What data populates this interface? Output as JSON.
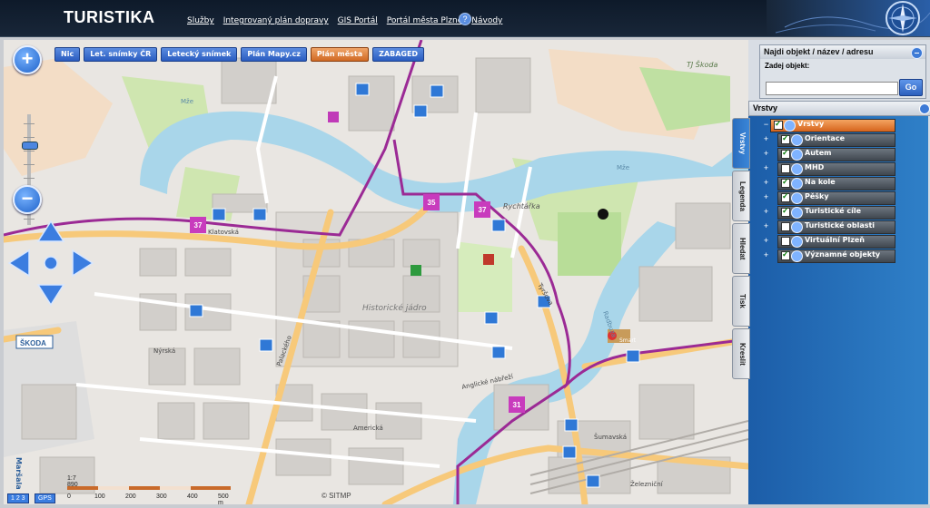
{
  "header": {
    "title": "TURISTIKA",
    "nav": [
      "Služby",
      "Integrovaný plán dopravy",
      "GIS Portál",
      "Portál města Plzně",
      "Návody"
    ],
    "help": "?"
  },
  "map": {
    "buttons": [
      "Nic",
      "Let. snímky ČR",
      "Letecký snímek",
      "Plán Mapy.cz",
      "Plán města",
      "ZABAGED"
    ],
    "active_button": "Plán města",
    "zoom_in": "+",
    "zoom_out": "−",
    "labels": {
      "district": "Historické jádro",
      "river1": "Mže",
      "river2": "Mže",
      "river3": "Radbuza",
      "street1": "Klatovská",
      "street2": "Americká",
      "street3": "Anglické nábřeží",
      "street4": "Šumavská",
      "street5": "Železniční",
      "street6": "Tyršova",
      "street7": "Palackého",
      "street8": "Nýrská",
      "tj": "TJ Škoda",
      "skoda": "ŠKODA",
      "rychtarka": "Rychtářka",
      "marshala": "Maršala",
      "smart": "Smart"
    },
    "route_badges": [
      "37",
      "35",
      "37",
      "31"
    ],
    "scale": {
      "ratio": "1:7 890",
      "ticks": [
        "0",
        "100",
        "200",
        "300",
        "400",
        "500 m"
      ]
    },
    "copyright": "© SITMP",
    "corner_buttons": [
      "1 2 3",
      "GPS"
    ]
  },
  "panel": {
    "find_title": "Najdi objekt / název / adresu",
    "find_label": "Zadej objekt:",
    "find_value": "",
    "go": "Go",
    "layers_title": "Vrstvy",
    "tabs": [
      "Vrstvy",
      "Legenda",
      "Hledat",
      "Tisk",
      "Kreslit"
    ],
    "selected_tab": "Vrstvy",
    "layers": [
      {
        "label": "Vrstvy",
        "checked": true,
        "root": true
      },
      {
        "label": "Orientace",
        "checked": true
      },
      {
        "label": "Autem",
        "checked": true
      },
      {
        "label": "MHD",
        "checked": false
      },
      {
        "label": "Na kole",
        "checked": true
      },
      {
        "label": "Pěšky",
        "checked": true
      },
      {
        "label": "Turistické cíle",
        "checked": true
      },
      {
        "label": "Turistické oblasti",
        "checked": false
      },
      {
        "label": "Virtuální Plzeň",
        "checked": false
      },
      {
        "label": "Významné objekty",
        "checked": true
      }
    ]
  }
}
